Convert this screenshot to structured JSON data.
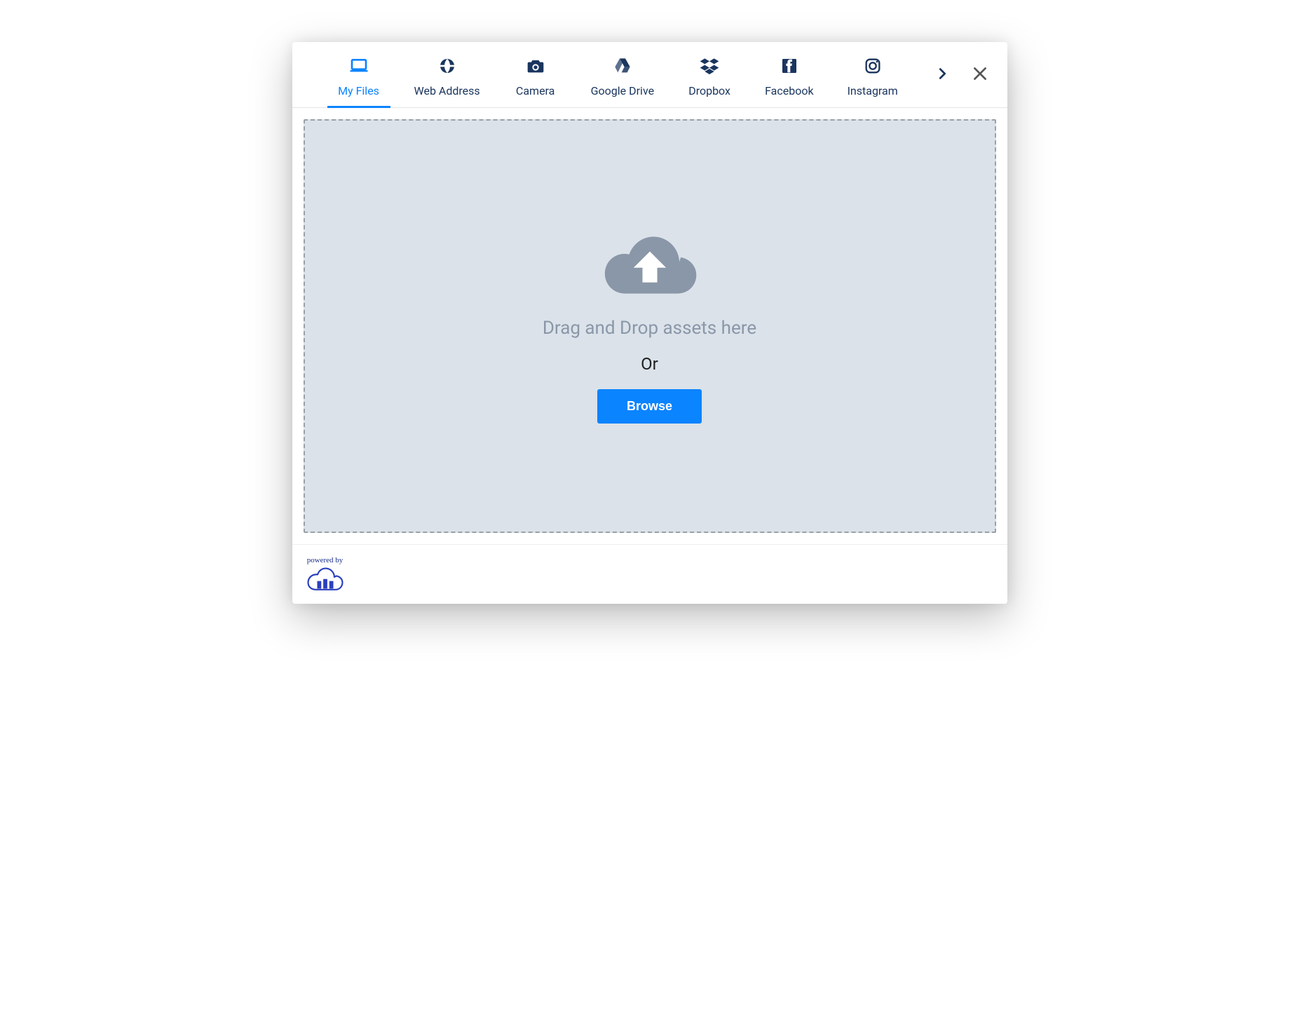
{
  "tabs": [
    {
      "id": "my-files",
      "label": "My Files",
      "active": true
    },
    {
      "id": "web-address",
      "label": "Web Address",
      "active": false
    },
    {
      "id": "camera",
      "label": "Camera",
      "active": false
    },
    {
      "id": "google-drive",
      "label": "Google Drive",
      "active": false
    },
    {
      "id": "dropbox",
      "label": "Dropbox",
      "active": false
    },
    {
      "id": "facebook",
      "label": "Facebook",
      "active": false
    },
    {
      "id": "instagram",
      "label": "Instagram",
      "active": false
    }
  ],
  "dropzone": {
    "drag_text": "Drag and Drop assets here",
    "or_text": "Or",
    "browse_label": "Browse"
  },
  "footer": {
    "powered_by": "powered by"
  }
}
